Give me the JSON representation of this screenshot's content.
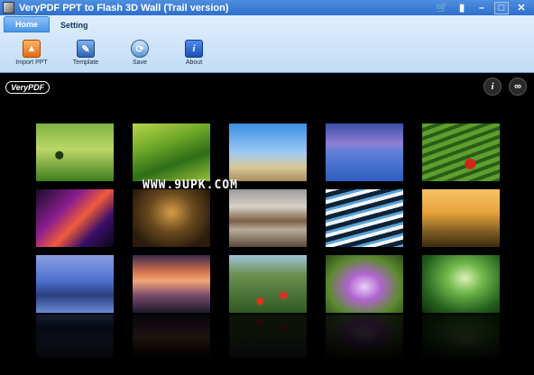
{
  "window": {
    "title": "VeryPDF PPT to Flash 3D Wall (Trail version)",
    "controls": {
      "cart_icon": "shopping-cart-icon",
      "book_icon": "book-icon",
      "minimize": "–",
      "maximize": "□",
      "close": "✕"
    }
  },
  "tabs": [
    {
      "label": "Home",
      "active": true
    },
    {
      "label": "Setting",
      "active": false
    }
  ],
  "toolbar": {
    "import_label": "Import PPT",
    "template_label": "Template",
    "save_label": "Save",
    "about_label": "About",
    "about_glyph": "i"
  },
  "viewer": {
    "logo_text": "VeryPDF",
    "info_glyph": "i",
    "link_glyph": "∞",
    "watermark": "WWW.9UPK.COM",
    "tiles": [
      "green-hills-tree",
      "rolling-green-fields",
      "frosted-tree-sky",
      "cracked-salt-flat",
      "tea-rows-red-umbrella",
      "colorful-rock-formation",
      "autumn-forest-path",
      "misty-valley",
      "terraced-rice-water",
      "temple-plain-sunrise",
      "bluebell-forest",
      "cloud-sea-sunset",
      "poppy-vineyard",
      "wisteria-tunnel",
      "mossy-forest-stream"
    ]
  },
  "colors": {
    "titlebar": "#2e6fcd",
    "ribbon": "#c3dcf6",
    "background": "#000000"
  }
}
